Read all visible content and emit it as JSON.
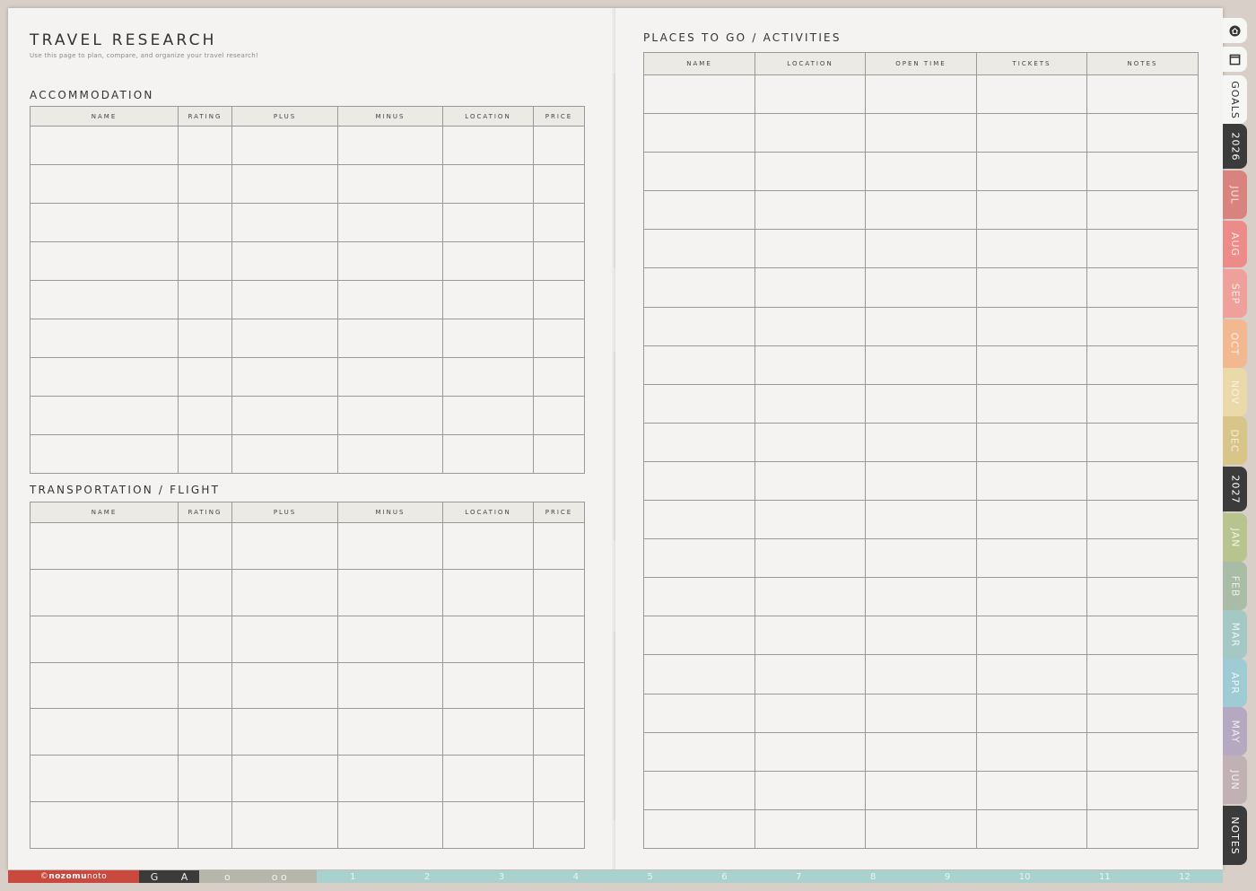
{
  "left_page": {
    "title": "TRAVEL RESEARCH",
    "subtitle": "Use this page to plan, compare, and organize your travel research!",
    "accommodation": {
      "title": "ACCOMMODATION",
      "columns": [
        "NAME",
        "RATING",
        "PLUS",
        "MINUS",
        "LOCATION",
        "PRICE"
      ],
      "rows": 9
    },
    "transportation": {
      "title": "TRANSPORTATION / FLIGHT",
      "columns": [
        "NAME",
        "RATING",
        "PLUS",
        "MINUS",
        "LOCATION",
        "PRICE"
      ],
      "rows": 7
    }
  },
  "right_page": {
    "places": {
      "title": "PLACES TO GO / ACTIVITIES",
      "columns": [
        "NAME",
        "LOCATION",
        "OPEN TIME",
        "TICKETS",
        "NOTES"
      ],
      "rows": 20
    }
  },
  "side_tabs": [
    {
      "label": "",
      "icon": "home-icon",
      "color": "#f6f6f4",
      "text_color": "#333"
    },
    {
      "label": "",
      "icon": "square-icon",
      "color": "#f6f6f4",
      "text_color": "#333"
    },
    {
      "label": "GOALS",
      "color": "#f6f6f4",
      "text_color": "#333"
    },
    {
      "label": "2026",
      "color": "#3b3b3b",
      "text_color": "#ffffff"
    },
    {
      "label": "JUL",
      "color": "#d9837e",
      "text_color": "#fbe9e7"
    },
    {
      "label": "AUG",
      "color": "#ed8b88",
      "text_color": "#fdeceb"
    },
    {
      "label": "SEP",
      "color": "#f0a09a",
      "text_color": "#fdeceb"
    },
    {
      "label": "OCT",
      "color": "#f2b88f",
      "text_color": "#fdf0e6"
    },
    {
      "label": "NOV",
      "color": "#ead9a9",
      "text_color": "#f8f2df"
    },
    {
      "label": "DEC",
      "color": "#d8c58a",
      "text_color": "#f5efd9"
    },
    {
      "label": "2027",
      "color": "#3b3b3b",
      "text_color": "#ffffff"
    },
    {
      "label": "JAN",
      "color": "#b8c48e",
      "text_color": "#f1f4e5"
    },
    {
      "label": "FEB",
      "color": "#a9bca5",
      "text_color": "#eef3ec"
    },
    {
      "label": "MAR",
      "color": "#a4c9c5",
      "text_color": "#edf5f4"
    },
    {
      "label": "APR",
      "color": "#9fcbd4",
      "text_color": "#ecf6f8"
    },
    {
      "label": "MAY",
      "color": "#b4a9c1",
      "text_color": "#f1eef5"
    },
    {
      "label": "JUN",
      "color": "#c2b1b4",
      "text_color": "#f4eff0"
    },
    {
      "label": "NOTES",
      "color": "#3b3b3b",
      "text_color": "#ffffff"
    }
  ],
  "bottom_bar": {
    "brand_prefix": "© ",
    "brand_bold": "nozomu",
    "brand_rest": "noto",
    "year_letters": [
      "G",
      "A"
    ],
    "mid_marks": [
      "o",
      "o o"
    ],
    "months": [
      "1",
      "2",
      "3",
      "4",
      "5",
      "6",
      "7",
      "8",
      "9",
      "10",
      "11",
      "12"
    ]
  }
}
